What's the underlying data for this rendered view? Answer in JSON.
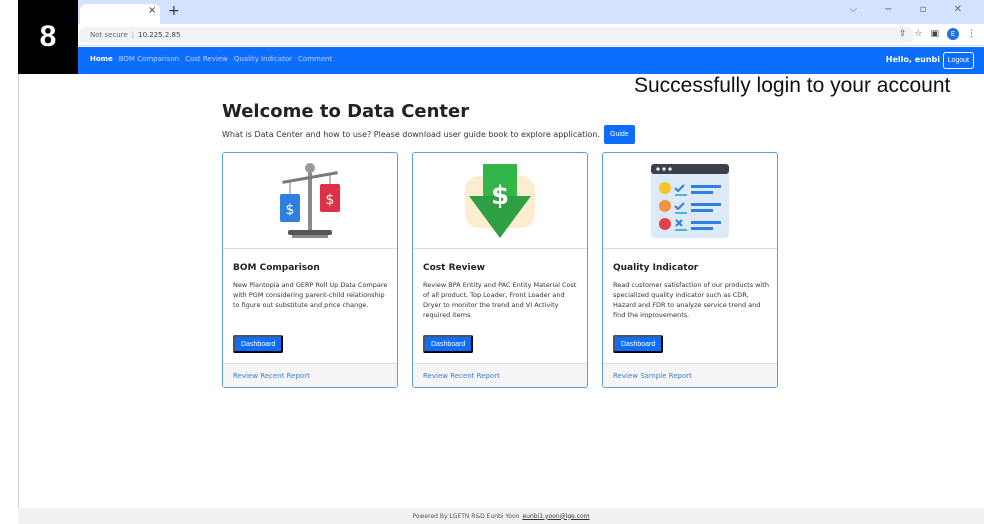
{
  "step_badge": "8",
  "browser": {
    "close_glyph": "×",
    "new_tab_glyph": "+",
    "window_controls": "⌵ − ▫ ✕",
    "not_secure": "Not secure",
    "url": "10.225.2.85",
    "profile_initial": "E"
  },
  "navbar": {
    "links": [
      "Home",
      "BOM Comparison",
      "Cost Review",
      "Quality Indicator",
      "Comment"
    ],
    "hello": "Hello, eunbi",
    "logout": "Logout"
  },
  "annotation": "Successfully login to your account",
  "main": {
    "title": "Welcome to Data Center",
    "subtitle": "What is Data Center and how to use? Please download user guide book to explore application.",
    "guide_label": "Guide"
  },
  "cards": [
    {
      "title": "BOM Comparison",
      "desc": "New Plantopia and GERP Roll Up Data Compare with PGM considering parent-child relationship to figure out substitute and price change.",
      "button": "Dashboard",
      "footer": "Review Recent Report",
      "icon": "scale-price-tags-icon"
    },
    {
      "title": "Cost Review",
      "desc": "Review BPA Entity and PAC Entity Material Cost of all product, Top Loader, Front Loader and Dryer to monitor the trend and VI Activity required items",
      "button": "Dashboard",
      "footer": "Review Recent Report",
      "icon": "dollar-down-arrow-icon"
    },
    {
      "title": "Quality Indicator",
      "desc": "Read customer satisfaction of our products with specialized quality indicator such as CDR, Hazard and FDR to analyze service trend and find the improvements.",
      "button": "Dashboard",
      "footer": "Review Sample Report",
      "icon": "satisfaction-survey-icon"
    }
  ],
  "footer": {
    "text": "Powered By LGETN R&D Eunbi Yoon",
    "email": "eunbi1.yoon@lge.com"
  },
  "colors": {
    "primary": "#0d6efd",
    "card_border": "#5aa0d8",
    "link": "#3a7fd0"
  }
}
